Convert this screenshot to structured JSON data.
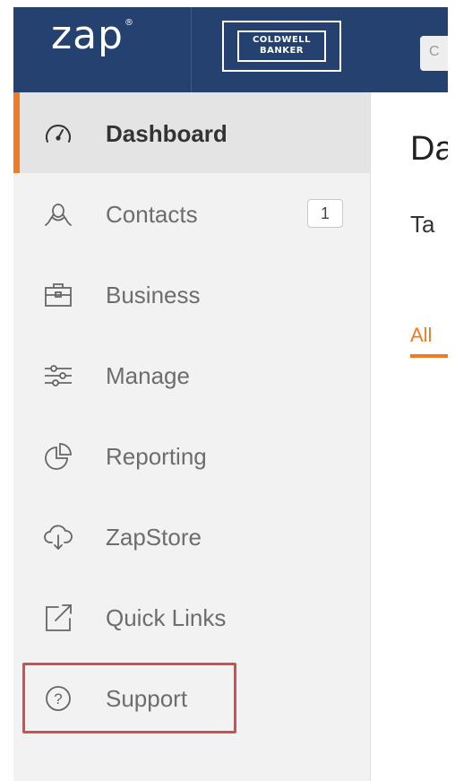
{
  "header": {
    "app_logo": "zap",
    "app_logo_mark": "®",
    "brand_logo": "COLDWELL BANKER",
    "brand_logo_line1": "COLDWELL",
    "brand_logo_line2": "BANKER",
    "search_placeholder_visible": "C"
  },
  "sidebar": {
    "items": [
      {
        "label": "Dashboard",
        "icon": "gauge-icon",
        "active": true
      },
      {
        "label": "Contacts",
        "icon": "user-icon",
        "badge": "1"
      },
      {
        "label": "Business",
        "icon": "briefcase-icon"
      },
      {
        "label": "Manage",
        "icon": "sliders-icon"
      },
      {
        "label": "Reporting",
        "icon": "pie-chart-icon"
      },
      {
        "label": "ZapStore",
        "icon": "cloud-download-icon"
      },
      {
        "label": "Quick Links",
        "icon": "external-link-icon"
      },
      {
        "label": "Support",
        "icon": "help-circle-icon",
        "highlighted": true
      }
    ]
  },
  "main": {
    "title": "Da",
    "subtitle": "Ta",
    "tab_all": "All"
  },
  "colors": {
    "header_bg": "#24416f",
    "accent": "#f07b22",
    "sidebar_bg": "#f2f2f2",
    "active_bg": "#e4e4e4",
    "highlight": "#d24f4f"
  }
}
